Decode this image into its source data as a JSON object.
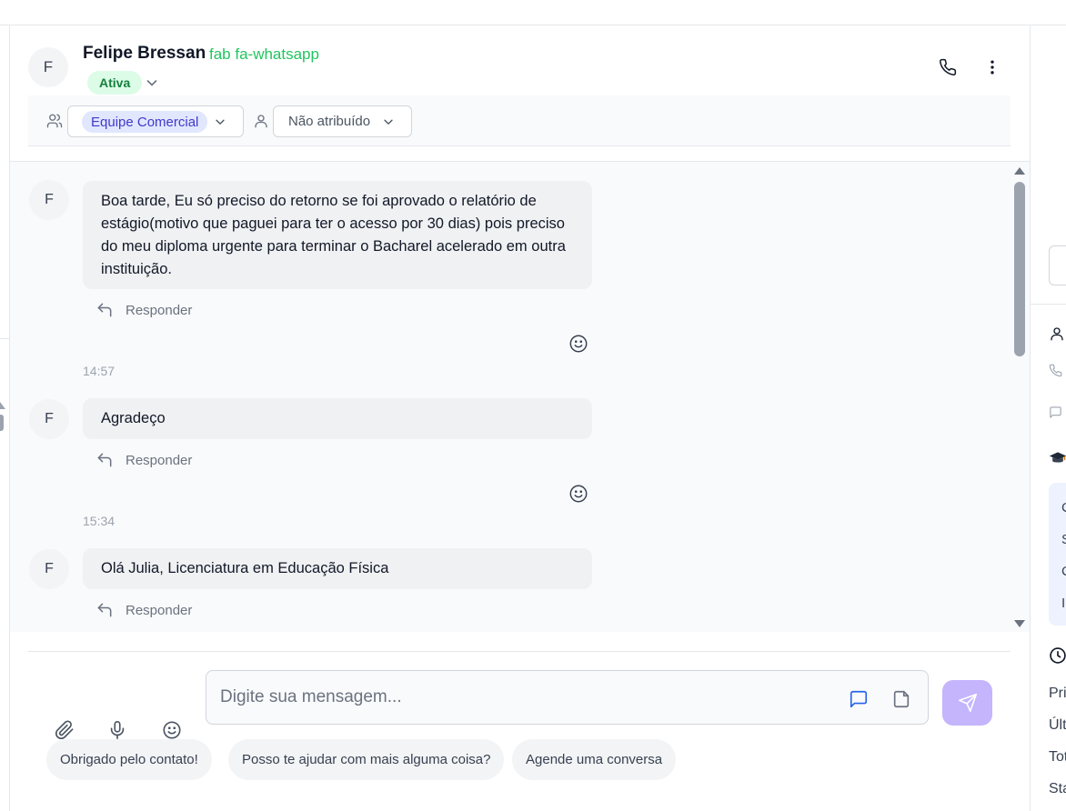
{
  "contact": {
    "initial": "F",
    "name": "Felipe Bressan",
    "channel_icon_text": "fab fa-whatsapp",
    "status": "Ativa"
  },
  "assignment": {
    "team": "Equipe Comercial",
    "agent": "Não atribuído"
  },
  "messages": [
    {
      "initial": "F",
      "text": "Boa tarde, Eu só preciso do retorno se foi aprovado o relatório de estágio(motivo que paguei para ter o acesso por 30 dias) pois preciso do meu diploma urgente para terminar o Bacharel acelerado em outra instituição.",
      "reply_label": "Responder"
    },
    {
      "time": "14:57",
      "initial": "F",
      "text": "Agradeço",
      "reply_label": "Responder"
    },
    {
      "time": "15:34",
      "initial": "F",
      "text": "Olá Julia, Licenciatura em Educação Física",
      "reply_label": "Responder"
    }
  ],
  "composer": {
    "placeholder": "Digite sua mensagem...",
    "quick_replies": [
      "Obrigado pelo contato!",
      "Posso te ajudar com mais alguma coisa?",
      "Agende uma conversa"
    ]
  },
  "right_panel": {
    "card_letters": [
      "C",
      "S",
      "C",
      "I"
    ],
    "stats_labels": [
      "Pri",
      "Últ",
      "Tot",
      "Sta"
    ]
  },
  "colors": {
    "status_bg": "#dcfce7",
    "status_text": "#15803d",
    "team_chip_bg": "#e0e7ff",
    "team_chip_text": "#4338ca",
    "channel": "#22c55e",
    "send_button": "#c4b5fd"
  }
}
